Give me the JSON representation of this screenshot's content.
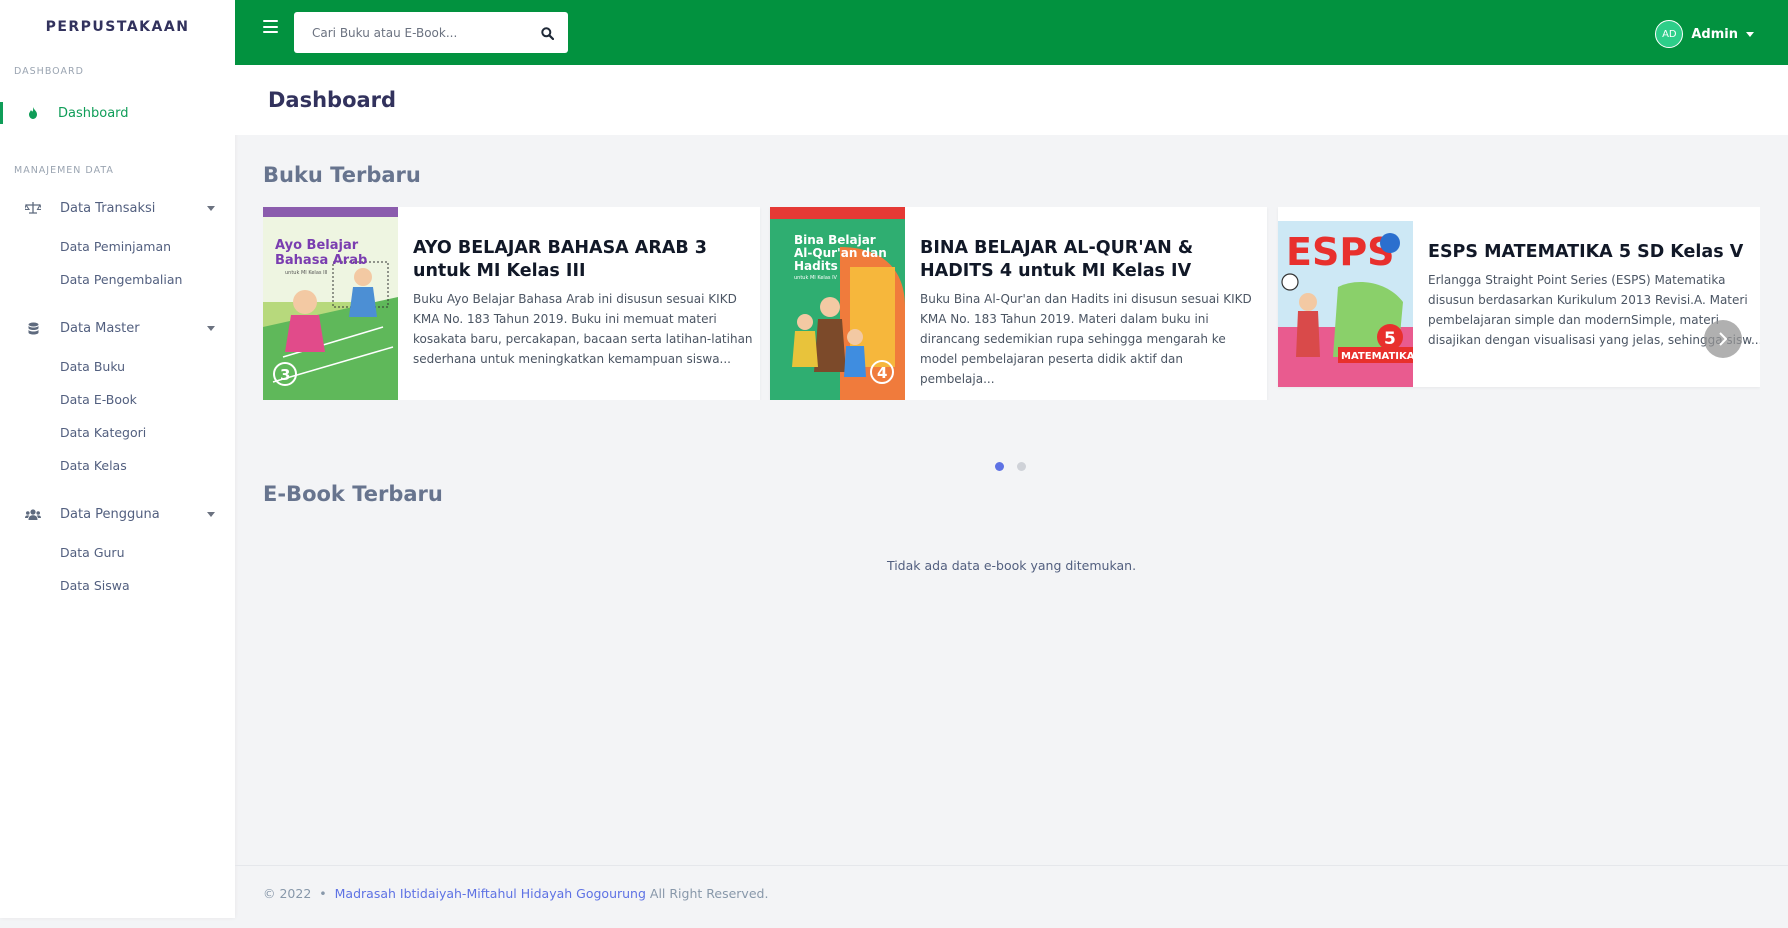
{
  "brand": "PERPUSTAKAAN",
  "sidebar": {
    "heading_dashboard": "DASHBOARD",
    "heading_manajemen": "MANAJEMEN DATA",
    "dashboard_label": "Dashboard",
    "groups": [
      {
        "label": "Data Transaksi",
        "icon": "balance-scale-icon",
        "items": [
          "Data Peminjaman",
          "Data Pengembalian"
        ]
      },
      {
        "label": "Data Master",
        "icon": "database-icon",
        "items": [
          "Data Buku",
          "Data E-Book",
          "Data Kategori",
          "Data Kelas"
        ]
      },
      {
        "label": "Data Pengguna",
        "icon": "users-icon",
        "items": [
          "Data Guru",
          "Data Siswa"
        ]
      }
    ]
  },
  "topbar": {
    "search_placeholder": "Cari Buku atau E-Book...",
    "user_initials": "AD",
    "user_name": "Admin",
    "bg_color": "#02923f"
  },
  "page": {
    "title": "Dashboard"
  },
  "books": {
    "section_title": "Buku Terbaru",
    "items": [
      {
        "title": "AYO BELAJAR BAHASA ARAB 3 untuk MI Kelas III",
        "desc": "Buku Ayo Belajar Bahasa Arab ini disusun sesuai KIKD KMA No. 183 Tahun 2019. Buku ini memuat materi kosakata baru, percakapan, bacaan serta latihan-latihan sederhana untuk meningkatkan kemampuan siswa...",
        "cover_title": "Ayo Belajar Bahasa Arab",
        "cover_sub": "untuk MI Kelas III",
        "cover_num": "3"
      },
      {
        "title": "BINA BELAJAR AL-QUR'AN & HADITS 4 untuk MI Kelas IV",
        "desc": "Buku Bina Al-Qur'an dan Hadits ini disusun sesuai KIKD KMA No. 183 Tahun 2019. Materi dalam buku ini dirancang sedemikian rupa sehingga mengarah ke model pembelajaran peserta didik aktif dan pembelaja...",
        "cover_title": "Bina Belajar Al-Qur'an dan Hadits",
        "cover_sub": "untuk MI Kelas IV",
        "cover_num": "4"
      },
      {
        "title": "ESPS MATEMATIKA 5 SD Kelas V",
        "desc": "Erlangga Straight Point Series (ESPS) Matematika disusun berdasarkan Kurikulum 2013 Revisi.A. Materi pembelajaran simple dan modernSimple, materi disajikan dengan visualisasi yang jelas, sehingga sisw...",
        "cover_title": "ESPS",
        "cover_sub": "MATEMATIKA",
        "cover_num": "5"
      }
    ]
  },
  "ebooks": {
    "section_title": "E-Book Terbaru",
    "empty_message": "Tidak ada data e-book yang ditemukan."
  },
  "footer": {
    "year": "© 2022",
    "separator": "•",
    "school": "Madrasah Ibtidaiyah-Miftahul Hidayah Gogourung",
    "rights": "All Right Reserved."
  }
}
